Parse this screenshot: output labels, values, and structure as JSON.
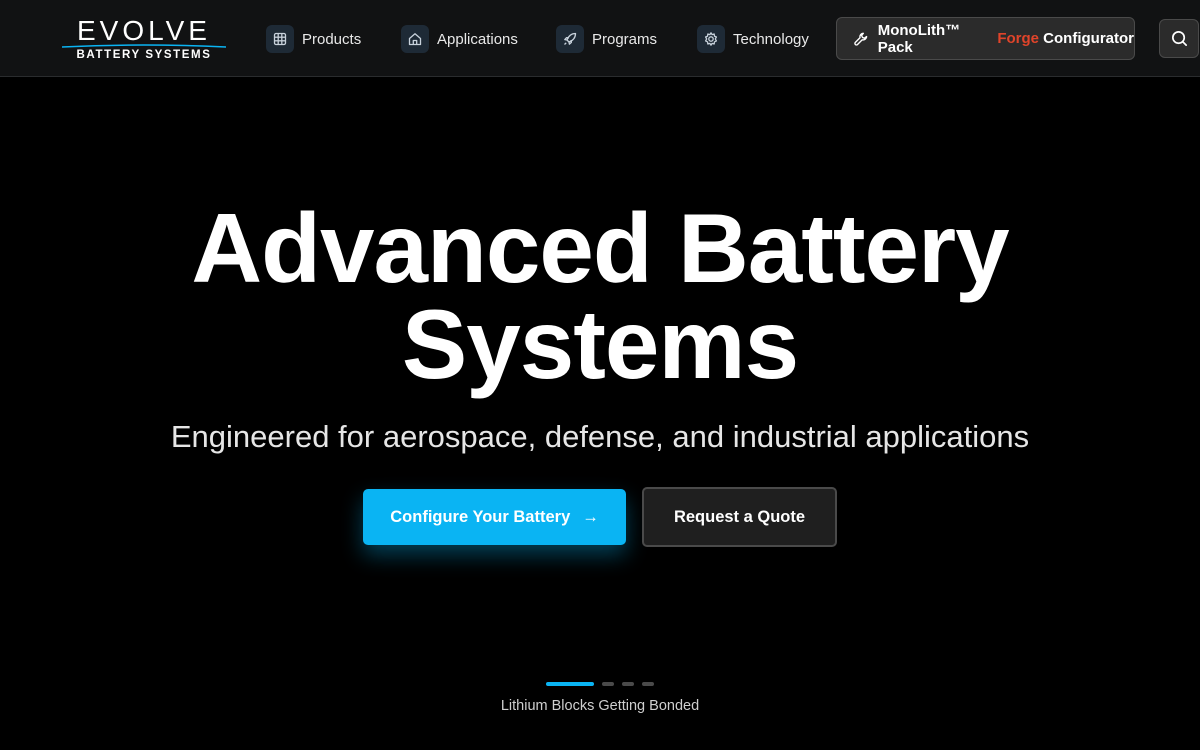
{
  "brand": {
    "logo_word": "EVOLVE",
    "logo_sub": "BATTERY SYSTEMS",
    "accent": "#0ab4f3",
    "forge_color": "#e0442a"
  },
  "nav": {
    "items": [
      {
        "label": "Products",
        "icon": "grid-icon"
      },
      {
        "label": "Applications",
        "icon": "home-icon"
      },
      {
        "label": "Programs",
        "icon": "rocket-icon"
      },
      {
        "label": "Technology",
        "icon": "gear-icon"
      }
    ],
    "configurator": {
      "prefix": "MonoLith™ Pack",
      "highlight": "Forge",
      "suffix": " Configurator",
      "icon": "wrench-icon"
    },
    "search_icon": "search-icon"
  },
  "hero": {
    "title_line1": "Advanced Battery",
    "title_line2": "Systems",
    "subtitle": "Engineered for aerospace, defense, and industrial applications",
    "primary_cta": "Configure Your Battery",
    "primary_cta_arrow": "→",
    "secondary_cta": "Request a Quote"
  },
  "carousel": {
    "slide_count": 4,
    "active_index": 0,
    "caption": "Lithium Blocks Getting Bonded"
  }
}
